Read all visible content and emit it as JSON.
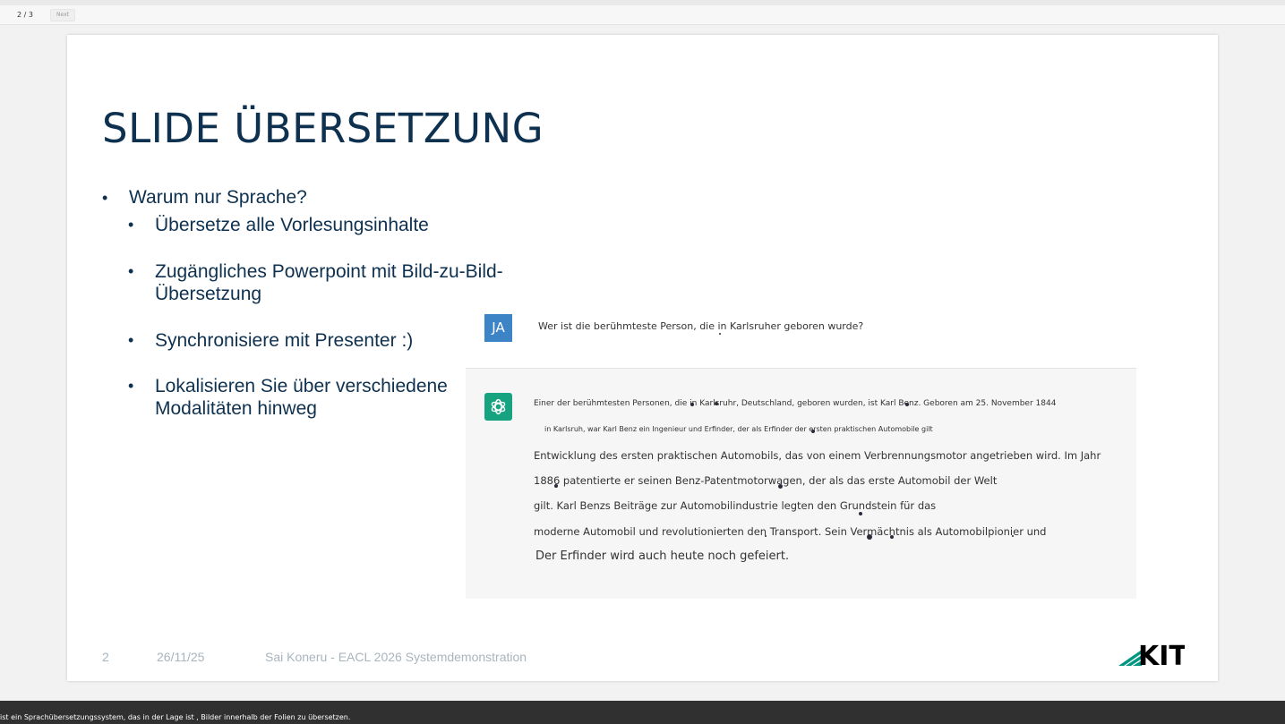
{
  "viewer": {
    "page_counter": "2 / 3",
    "next_label": "Next"
  },
  "slide": {
    "title": "SLIDE ÜBERSETZUNG",
    "bullets": {
      "main": "Warum nur Sprache?",
      "sub1": "Übersetze alle Vorlesungsinhalte",
      "sub2": "Zugängliches Powerpoint mit Bild-zu-Bild-Übersetzung",
      "sub3": "Synchronisiere mit Presenter :)",
      "sub4": "Lokalisieren Sie über verschiedene Modalitäten hinweg"
    },
    "chat": {
      "user_initials": "JA",
      "user_message": "Wer ist die berühmteste Person, die in Karlsruher geboren wurde?",
      "bot_icon": "openai-logo-icon",
      "bot_lines": [
        "Einer der berühmtesten Personen, die in Karlsruhr, Deutschland, geboren wurden, ist Karl Benz. Geboren am 25. November 1844",
        "in Karlsruh, war Karl Benz ein Ingenieur und Erfinder, der als Erfinder der ersten praktischen Automobile gilt",
        "Entwicklung des ersten praktischen Automobils, das von einem Verbrennungsmotor angetrieben wird. Im Jahr",
        "1886 patentierte er seinen Benz-Patentmotorwagen, der als das erste Automobil der Welt",
        "gilt. Karl Benzs Beiträge zur Automobilindustrie legten den Grundstein für das",
        "moderne Automobil und revolutionierten den Transport. Sein Vermächtnis als Automobilpionier und",
        "Der Erfinder wird auch heute noch gefeiert."
      ]
    },
    "footer": {
      "page_number": "2",
      "date": "26/11/25",
      "author": "Sai Koneru - EACL 2026 Systemdemonstration",
      "logo_text": "KIT"
    }
  },
  "caption": "ist ein Sprachübersetzungssystem, das in der Lage ist , Bilder innerhalb der Folien zu übersetzen.",
  "colors": {
    "title": "#0e3150",
    "kit_green": "#009682",
    "user_avatar": "#3d84c6",
    "bot_avatar": "#17a37f"
  }
}
